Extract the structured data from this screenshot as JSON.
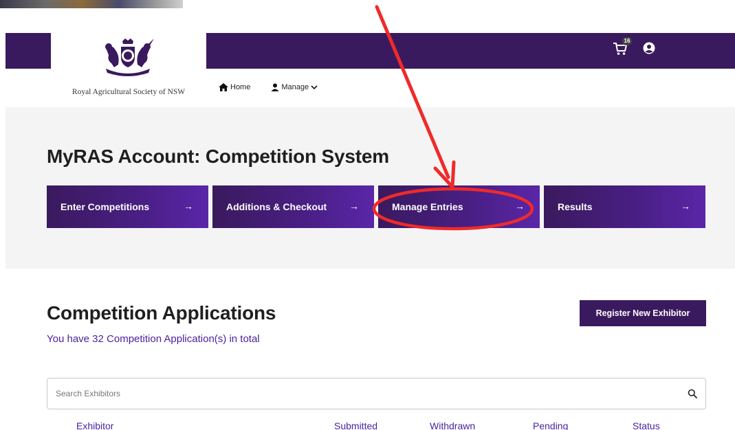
{
  "header": {
    "org_name": "Royal Agricultural Society of NSW",
    "cart_count": "16",
    "nav": {
      "home": "Home",
      "manage": "Manage"
    }
  },
  "hero": {
    "title": "MyRAS Account: Competition System",
    "tiles": [
      {
        "label": "Enter Competitions",
        "arrow": "→"
      },
      {
        "label": "Additions & Checkout",
        "arrow": "→"
      },
      {
        "label": "Manage Entries",
        "arrow": "→"
      },
      {
        "label": "Results",
        "arrow": "→"
      }
    ]
  },
  "applications": {
    "title": "Competition Applications",
    "count_text": "You have 32 Competition Application(s) in total",
    "register_label": "Register New Exhibitor",
    "search_placeholder": "Search Exhibitors",
    "columns": [
      "Exhibitor",
      "Submitted",
      "Withdrawn",
      "Pending",
      "Status"
    ]
  },
  "colors": {
    "brand_purple": "#3a1a5e",
    "accent_purple": "#4a1f9e",
    "annotation_red": "#f02a2a"
  }
}
